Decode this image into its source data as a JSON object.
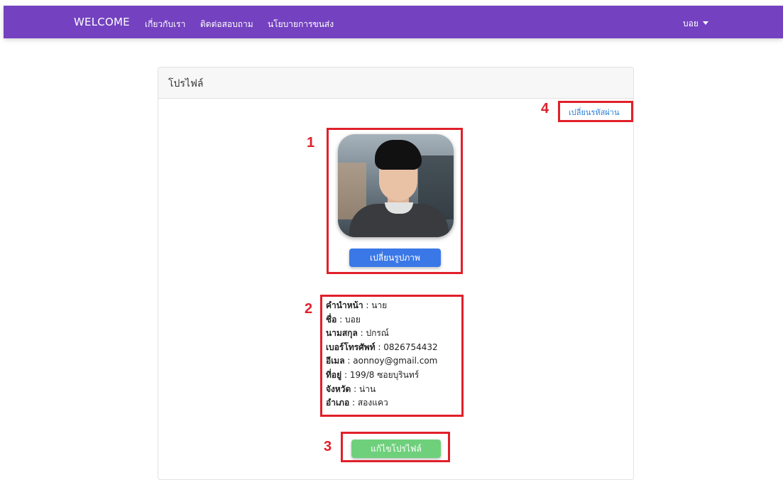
{
  "navbar": {
    "brand": "WELCOME",
    "links": [
      "เกี่ยวกับเรา",
      "ติดต่อสอบถาม",
      "นโยบายการขนส่ง"
    ],
    "user": "บอย",
    "background": "#7442c0"
  },
  "card": {
    "title": "โปรไฟล์",
    "change_password_label": "เปลี่ยนรหัสผ่าน",
    "change_photo_label": "เปลี่ยนรูปภาพ",
    "edit_profile_label": "แก้ไขโปรไฟล์",
    "info": [
      {
        "label": "คำนำหน้า",
        "value": "นาย"
      },
      {
        "label": "ชื่อ",
        "value": "บอย"
      },
      {
        "label": "นามสกุล",
        "value": "ปกรณ์"
      },
      {
        "label": "เบอร์โทรศัพท์",
        "value": "0826754432"
      },
      {
        "label": "อีเมล",
        "value": "aonnoy@gmail.com"
      },
      {
        "label": "ที่อยู่",
        "value": "199/8 ซอยบุรินทร์"
      },
      {
        "label": "จังหวัด",
        "value": "น่าน"
      },
      {
        "label": "อำเภอ",
        "value": "สองแคว"
      }
    ],
    "separator": " : "
  },
  "annotations": [
    "1",
    "2",
    "3",
    "4"
  ],
  "colors": {
    "primary_button": "#3b78e7",
    "success_button": "#6fd07c",
    "link": "#2d7fd8",
    "annotation": "#e0202a"
  }
}
